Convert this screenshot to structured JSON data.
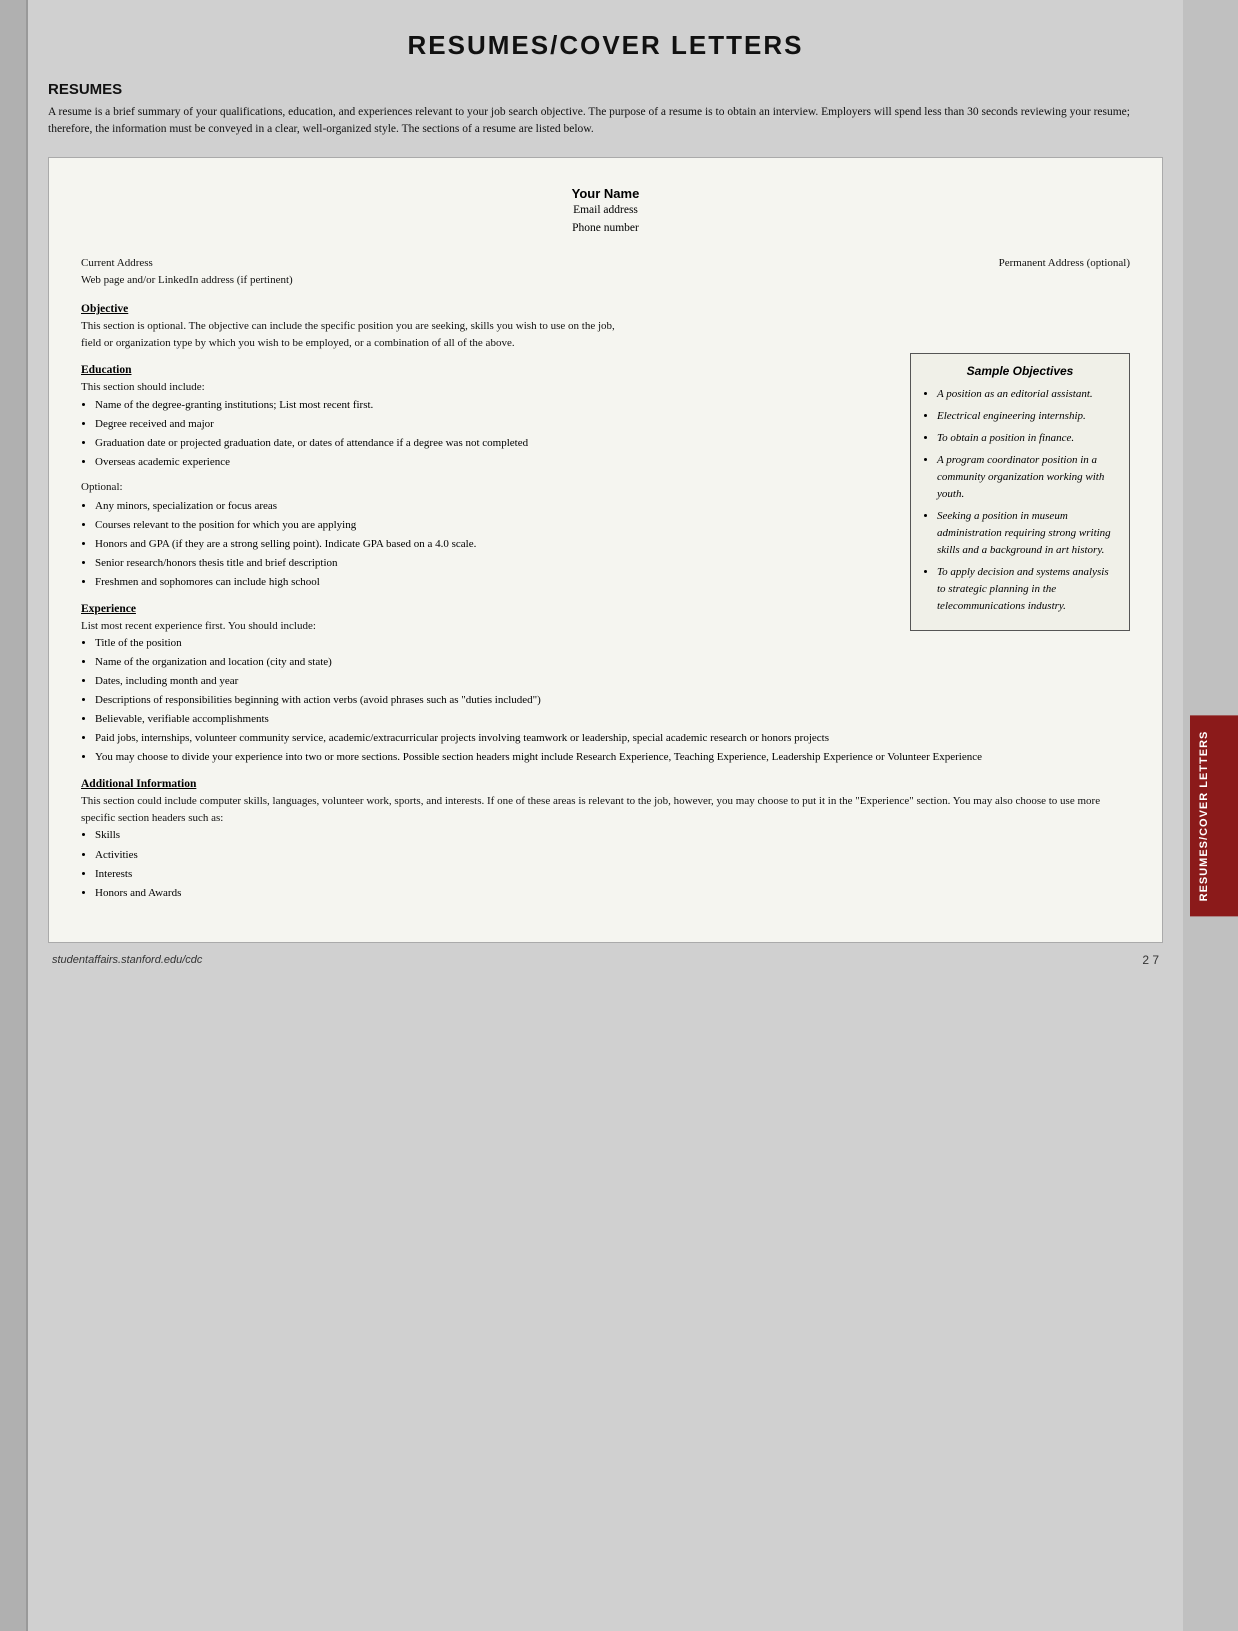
{
  "page": {
    "title": "RESUMES/COVER LETTERS",
    "right_tab": "RESUMES/COVER LETTERS",
    "footer_url": "studentaffairs.stanford.edu/cdc",
    "footer_page": "2 7"
  },
  "resumes_section": {
    "heading": "RESUMES",
    "intro": "A resume is a brief summary of your qualifications, education, and experiences relevant to your job search objective. The purpose of a resume is to obtain an interview. Employers will spend less than 30 seconds reviewing your resume; therefore, the information must be conveyed in a clear, well-organized style. The sections of a resume are listed below."
  },
  "resume_doc": {
    "name": "Your Name",
    "email": "Email address",
    "phone": "Phone number",
    "current_address": "Current Address",
    "web_address": "Web page and/or LinkedIn address (if pertinent)",
    "permanent_address": "Permanent Address (optional)",
    "objective_title": "Objective",
    "objective_text": "This section is optional. The objective can include the specific position you are seeking, skills you wish to use on the job, field or organization type by which you wish to be employed, or a combination of all of the above.",
    "education_title": "Education",
    "education_intro": "This section should include:",
    "education_bullets": [
      "Name of the degree-granting institutions; List most recent first.",
      "Degree received and major",
      "Graduation date or projected graduation date, or dates of attendance if a degree was not completed",
      "Overseas academic experience"
    ],
    "optional_label": "Optional:",
    "optional_bullets": [
      "Any minors, specialization or focus areas",
      "Courses relevant to the position for which you are applying",
      "Honors and GPA (if they are a strong selling point). Indicate GPA based on a 4.0 scale.",
      "Senior research/honors thesis title and brief description",
      "Freshmen and sophomores can include high school"
    ],
    "experience_title": "Experience",
    "experience_intro": "List most recent experience first. You should include:",
    "experience_bullets": [
      "Title of the position",
      "Name of the organization and location (city and state)",
      "Dates, including month and year",
      "Descriptions of responsibilities beginning with action verbs (avoid phrases such as \"duties included\")",
      "Believable, verifiable accomplishments",
      "Paid jobs, internships, volunteer community service, academic/extracurricular projects involving teamwork or leadership, special academic research or honors projects",
      "You may choose to divide your experience into two or more sections. Possible section headers might include Research Experience, Teaching Experience, Leadership Experience or Volunteer Experience"
    ],
    "additional_title": "Additional Information",
    "additional_text": "This section could include computer skills, languages, volunteer work, sports, and interests. If one of these areas is relevant to the job, however, you may choose to put it in the \"Experience\" section. You may also choose to use more specific section headers such as:",
    "additional_bullets": [
      "Skills",
      "Activities",
      "Interests",
      "Honors and Awards"
    ]
  },
  "sample_objectives": {
    "title": "Sample Objectives",
    "items": [
      "A position as an editorial assistant.",
      "Electrical engineering internship.",
      "To obtain a position in finance.",
      "A program coordinator position in a community organization working with youth.",
      "Seeking a position in museum administration requiring strong writing skills and a background in art history.",
      "To apply decision and systems analysis to strategic planning in the telecommunications industry."
    ]
  }
}
